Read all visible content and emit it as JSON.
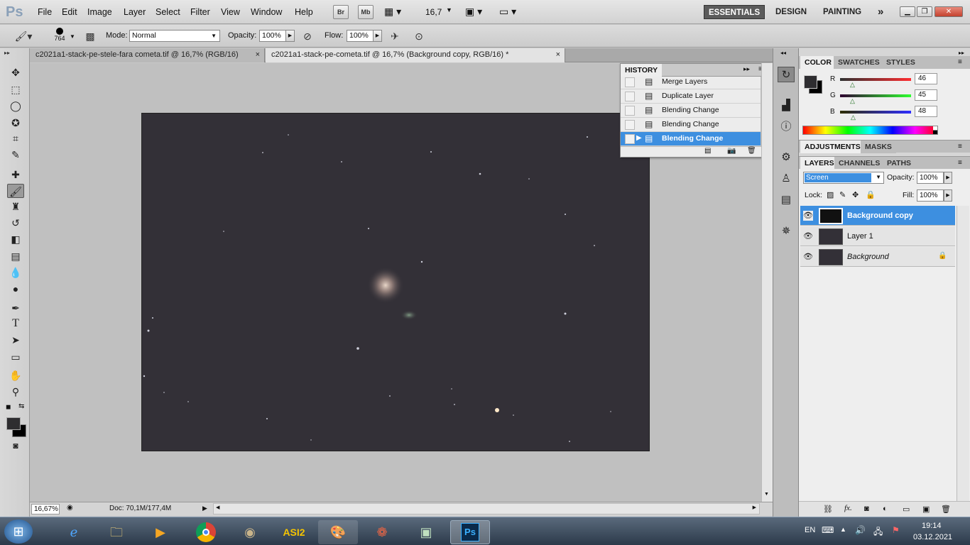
{
  "app": {
    "logo": "Ps"
  },
  "menu": [
    "File",
    "Edit",
    "Image",
    "Layer",
    "Select",
    "Filter",
    "View",
    "Window",
    "Help"
  ],
  "top_tools": {
    "br": "Br",
    "mb": "Mb",
    "zoom": "16,7"
  },
  "workspaces": {
    "essentials": "ESSENTIALS",
    "design": "DESIGN",
    "painting": "PAINTING",
    "more": "»"
  },
  "options": {
    "brush_size": "764",
    "mode_label": "Mode:",
    "mode_value": "Normal",
    "opacity_label": "Opacity:",
    "opacity_value": "100%",
    "flow_label": "Flow:",
    "flow_value": "100%"
  },
  "tabs": [
    {
      "label": "c2021a1-stack-pe-stele-fara cometa.tif @ 16,7% (RGB/16)",
      "close": "×"
    },
    {
      "label": "c2021a1-stack-pe-cometa.tif @ 16,7% (Background copy, RGB/16) *",
      "close": "×"
    }
  ],
  "status": {
    "zoom": "16,67%",
    "doc": "Doc: 70,1M/177,4M"
  },
  "history": {
    "title": "HISTORY",
    "items": [
      {
        "label": "Merge Layers"
      },
      {
        "label": "Duplicate Layer"
      },
      {
        "label": "Blending Change"
      },
      {
        "label": "Blending Change"
      },
      {
        "label": "Blending Change"
      }
    ]
  },
  "color_panel": {
    "tabs": [
      "COLOR",
      "SWATCHES",
      "STYLES"
    ],
    "r_label": "R",
    "r_value": "46",
    "g_label": "G",
    "g_value": "45",
    "b_label": "B",
    "b_value": "48",
    "r_fraction": 0.18,
    "g_fraction": 0.18,
    "b_fraction": 0.19,
    "fg_color": "#2e2d30"
  },
  "adjust_panel": {
    "tabs": [
      "ADJUSTMENTS",
      "MASKS"
    ]
  },
  "layers_panel": {
    "tabs": [
      "LAYERS",
      "CHANNELS",
      "PATHS"
    ],
    "blend_mode": "Screen",
    "opacity_label": "Opacity:",
    "opacity_value": "100%",
    "lock_label": "Lock:",
    "fill_label": "Fill:",
    "fill_value": "100%",
    "layers": [
      {
        "name": "Background copy"
      },
      {
        "name": "Layer 1"
      },
      {
        "name": "Background"
      }
    ]
  },
  "taskbar": {
    "lang": "EN",
    "time": "19:14",
    "date": "03.12.2021",
    "asi": "ASI2"
  },
  "colors": {
    "accent": "#3d8fe0",
    "canvas_bg": "#c0c0c0",
    "image_bg": "#333037"
  }
}
